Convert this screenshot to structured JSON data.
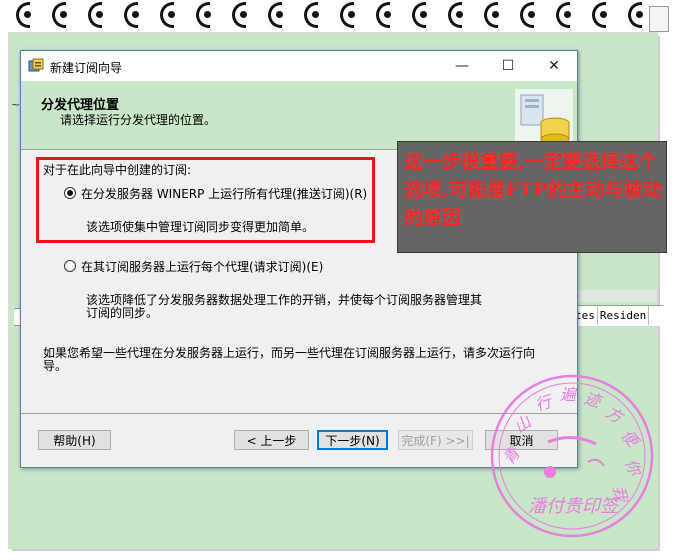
{
  "dialog": {
    "title": "新建订阅向导",
    "header_title": "分发代理位置",
    "header_subtitle": "请选择运行分发代理的位置。",
    "group_label": "对于在此向导中创建的订阅:",
    "option1_label": "在分发服务器 WINERP 上运行所有代理(推送订阅)(R)",
    "option1_desc": "该选项使集中管理订阅同步变得更加简单。",
    "option2_label": "在其订阅服务器上运行每个代理(请求订阅)(E)",
    "option2_desc_line1": "该选项降低了分发服务器数据处理工作的开销，并使每个订阅服务器管理其",
    "option2_desc_line2": "订阅的同步。",
    "note_line1": "如果您希望一些代理在分发服务器上运行，而另一些代理在订阅服务器上运行，请多次运行向",
    "note_line2": "导。",
    "buttons": {
      "help": "帮助(H)",
      "back": "< 上一步",
      "next": "下一步(N)",
      "finish": "完成(F) >>|",
      "cancel": "取消"
    },
    "selected_option": 1
  },
  "window_controls": {
    "minimize": "—",
    "maximize": "☐",
    "close": "✕"
  },
  "background_app": {
    "tilde": "~",
    "columns": [
      "tes",
      "Residen"
    ]
  },
  "annotation": {
    "text": "这一步很重要,一定要选择这个选项,可能是FTP的主动与被动的原因",
    "color": "#ff2626"
  },
  "stamp": {
    "text": "青山行遍迹方便你我他 潘付贵印签"
  },
  "colors": {
    "page_green": "#c8e6c8",
    "stamp_pink": "#e87ee0",
    "highlight_red": "#e8141e"
  }
}
